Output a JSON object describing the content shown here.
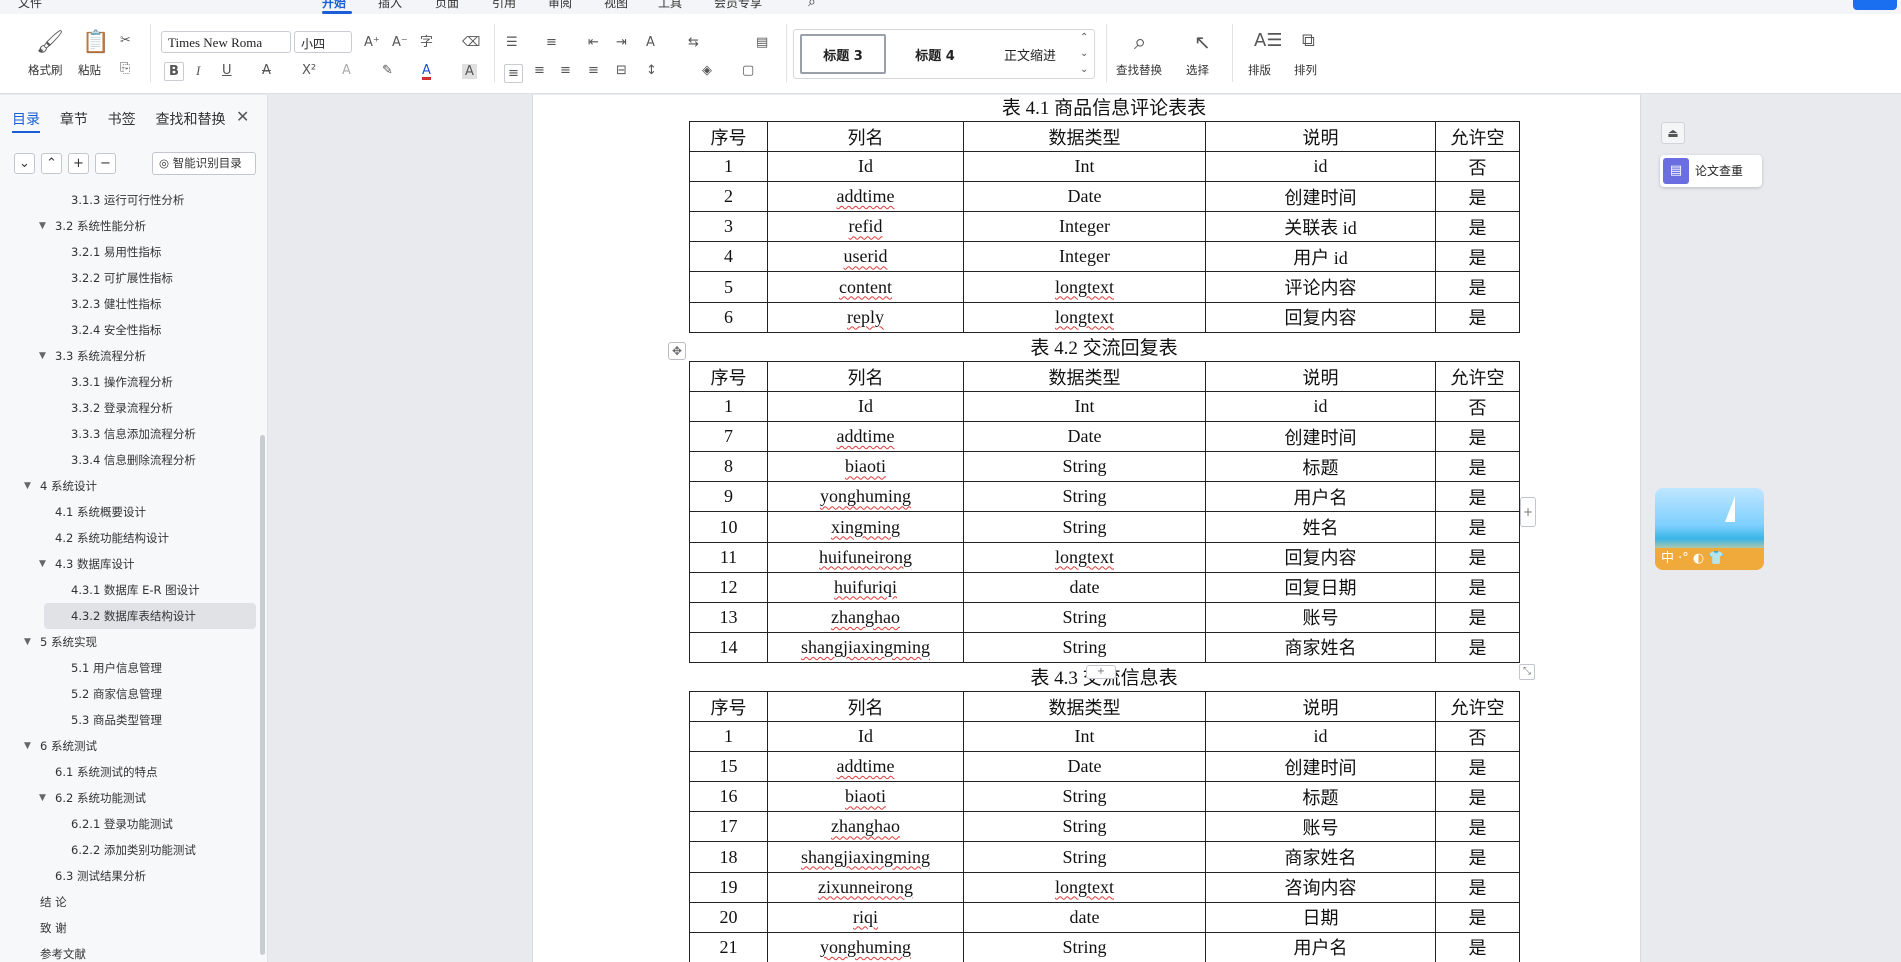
{
  "tabs": {
    "file": "文件",
    "start": "开始",
    "insert": "插入",
    "page": "页面",
    "reference": "引用",
    "review": "审阅",
    "view": "视图",
    "tools": "工具",
    "member": "会员专享"
  },
  "ribbon": {
    "format_painter": "格式刷",
    "paste": "粘贴",
    "font_name": "Times New Roma",
    "font_size": "小四",
    "styles": [
      "标题 3",
      "标题 4",
      "正文缩进"
    ],
    "find_replace": "查找替换",
    "select": "选择",
    "layout": "排版",
    "arrange": "排列"
  },
  "nav": {
    "tabs": [
      "目录",
      "章节",
      "书签",
      "查找和替换"
    ],
    "smart_btn": "智能识别目录",
    "toc": [
      {
        "t": "3.1.3  运行可行性分析",
        "lvl": 3,
        "arrow": false
      },
      {
        "t": "3.2  系统性能分析",
        "lvl": 2,
        "arrow": true
      },
      {
        "t": "3.2.1  易用性指标",
        "lvl": 3,
        "arrow": false
      },
      {
        "t": "3.2.2  可扩展性指标",
        "lvl": 3,
        "arrow": false
      },
      {
        "t": "3.2.3  健壮性指标",
        "lvl": 3,
        "arrow": false
      },
      {
        "t": "3.2.4  安全性指标",
        "lvl": 3,
        "arrow": false
      },
      {
        "t": "3.3  系统流程分析",
        "lvl": 2,
        "arrow": true
      },
      {
        "t": "3.3.1  操作流程分析",
        "lvl": 3,
        "arrow": false
      },
      {
        "t": "3.3.2  登录流程分析",
        "lvl": 3,
        "arrow": false
      },
      {
        "t": "3.3.3  信息添加流程分析",
        "lvl": 3,
        "arrow": false
      },
      {
        "t": "3.3.4  信息删除流程分析",
        "lvl": 3,
        "arrow": false
      },
      {
        "t": "4  系统设计",
        "lvl": 1,
        "arrow": true
      },
      {
        "t": "4.1  系统概要设计",
        "lvl": 2,
        "arrow": false
      },
      {
        "t": "4.2  系统功能结构设计",
        "lvl": 2,
        "arrow": false
      },
      {
        "t": "4.3  数据库设计",
        "lvl": 2,
        "arrow": true
      },
      {
        "t": "4.3.1  数据库 E-R 图设计",
        "lvl": 3,
        "arrow": false
      },
      {
        "t": "4.3.2  数据库表结构设计",
        "lvl": 3,
        "arrow": false,
        "sel": true
      },
      {
        "t": "5  系统实现",
        "lvl": 1,
        "arrow": true
      },
      {
        "t": "5.1 用户信息管理",
        "lvl": 3,
        "arrow": false
      },
      {
        "t": "5.2  商家信息管理",
        "lvl": 3,
        "arrow": false
      },
      {
        "t": "5.3 商品类型管理",
        "lvl": 3,
        "arrow": false
      },
      {
        "t": "6  系统测试",
        "lvl": 1,
        "arrow": true
      },
      {
        "t": "6.1  系统测试的特点",
        "lvl": 2,
        "arrow": false
      },
      {
        "t": "6.2  系统功能测试",
        "lvl": 2,
        "arrow": true
      },
      {
        "t": "6.2.1  登录功能测试",
        "lvl": 3,
        "arrow": false
      },
      {
        "t": "6.2.2  添加类别功能测试",
        "lvl": 3,
        "arrow": false
      },
      {
        "t": "6.3  测试结果分析",
        "lvl": 2,
        "arrow": false
      },
      {
        "t": "结    论",
        "lvl": 1,
        "arrow": false
      },
      {
        "t": "致    谢",
        "lvl": 1,
        "arrow": false
      },
      {
        "t": "参考文献",
        "lvl": 1,
        "arrow": false
      }
    ]
  },
  "doc": {
    "header": [
      "序号",
      "列名",
      "数据类型",
      "说明",
      "允许空"
    ],
    "tables": [
      {
        "caption": "表 4.1 商品信息评论表表",
        "rows": [
          [
            "1",
            "Id",
            "Int",
            "id",
            "否"
          ],
          [
            "2",
            "addtime",
            "Date",
            "创建时间",
            "是"
          ],
          [
            "3",
            "refid",
            "Integer",
            "关联表 id",
            "是"
          ],
          [
            "4",
            "userid",
            "Integer",
            "用户 id",
            "是"
          ],
          [
            "5",
            "content",
            "longtext",
            "评论内容",
            "是"
          ],
          [
            "6",
            "reply",
            "longtext",
            "回复内容",
            "是"
          ]
        ]
      },
      {
        "caption": "表 4.2 交流回复表",
        "rows": [
          [
            "1",
            "Id",
            "Int",
            "id",
            "否"
          ],
          [
            "7",
            "addtime",
            "Date",
            "创建时间",
            "是"
          ],
          [
            "8",
            "biaoti",
            "String",
            "标题",
            "是"
          ],
          [
            "9",
            "yonghuming",
            "String",
            "用户名",
            "是"
          ],
          [
            "10",
            "xingming",
            "String",
            "姓名",
            "是"
          ],
          [
            "11",
            "huifuneirong",
            "longtext",
            "回复内容",
            "是"
          ],
          [
            "12",
            "huifuriqi",
            "date",
            "回复日期",
            "是"
          ],
          [
            "13",
            "zhanghao",
            "String",
            "账号",
            "是"
          ],
          [
            "14",
            "shangjiaxingming",
            "String",
            "商家姓名",
            "是"
          ]
        ]
      },
      {
        "caption": "表 4.3 交流信息表",
        "rows": [
          [
            "1",
            "Id",
            "Int",
            "id",
            "否"
          ],
          [
            "15",
            "addtime",
            "Date",
            "创建时间",
            "是"
          ],
          [
            "16",
            "biaoti",
            "String",
            "标题",
            "是"
          ],
          [
            "17",
            "zhanghao",
            "String",
            "账号",
            "是"
          ],
          [
            "18",
            "shangjiaxingming",
            "String",
            "商家姓名",
            "是"
          ],
          [
            "19",
            "zixunneirong",
            "longtext",
            "咨询内容",
            "是"
          ],
          [
            "20",
            "riqi",
            "date",
            "日期",
            "是"
          ],
          [
            "21",
            "yonghuming",
            "String",
            "用户名",
            "是"
          ]
        ]
      }
    ]
  },
  "side": {
    "paper_check": "论文查重",
    "ime": "中"
  }
}
